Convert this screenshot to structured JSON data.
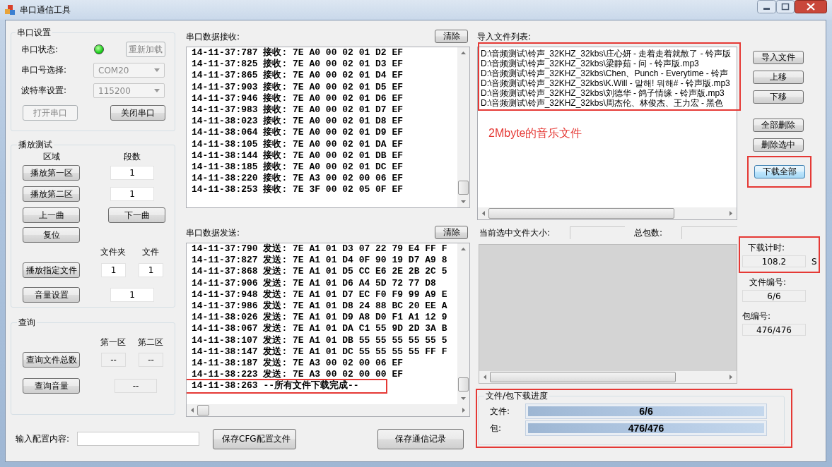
{
  "window": {
    "title": "串口通信工具"
  },
  "serial_settings": {
    "title": "串口设置",
    "status_label": "串口状态:",
    "connected": true,
    "reload_button": {
      "label": "重新加载",
      "disabled": true
    },
    "port_label": "串口号选择:",
    "port": {
      "value": "COM20",
      "disabled": true
    },
    "baud_label": "波特率设置:",
    "baud": {
      "value": "115200",
      "disabled": true
    },
    "open_button": {
      "label": "打开串口",
      "disabled": true
    },
    "close_button": {
      "label": "关闭串口",
      "disabled": false
    }
  },
  "play_test": {
    "title": "播放测试",
    "zone_header": "区域",
    "count_header": "段数",
    "zone1_button": "播放第一区",
    "zone1_count": "1",
    "zone2_button": "播放第二区",
    "zone2_count": "1",
    "prev_button": "上一曲",
    "next_button": "下一曲",
    "reset_button": "复位",
    "folder_header": "文件夹",
    "file_header": "文件",
    "play_file_button": "播放指定文件",
    "folder_value": "1",
    "file_value": "1",
    "volume_button": "音量设置",
    "volume_value": "1"
  },
  "query": {
    "title": "查询",
    "zone1_header": "第一区",
    "zone2_header": "第二区",
    "file_count_button": "查询文件总数",
    "zone1_count": "--",
    "zone2_count": "--",
    "volume_button": "查询音量",
    "volume": "--"
  },
  "config": {
    "label": "输入配置内容:",
    "save_cfg_button": "保存CFG配置文件",
    "save_log_button": "保存通信记录"
  },
  "receive": {
    "label": "串口数据接收:",
    "clear_button": "清除",
    "lines": [
      "14-11-37:787 接收: 7E A0 00 02 01 D2 EF",
      "14-11-37:825 接收: 7E A0 00 02 01 D3 EF",
      "14-11-37:865 接收: 7E A0 00 02 01 D4 EF",
      "14-11-37:903 接收: 7E A0 00 02 01 D5 EF",
      "14-11-37:946 接收: 7E A0 00 02 01 D6 EF",
      "14-11-37:983 接收: 7E A0 00 02 01 D7 EF",
      "14-11-38:023 接收: 7E A0 00 02 01 D8 EF",
      "14-11-38:064 接收: 7E A0 00 02 01 D9 EF",
      "14-11-38:105 接收: 7E A0 00 02 01 DA EF",
      "14-11-38:144 接收: 7E A0 00 02 01 DB EF",
      "14-11-38:185 接收: 7E A0 00 02 01 DC EF",
      "14-11-38:220 接收: 7E A3 00 02 00 06 EF",
      "14-11-38:253 接收: 7E 3F 00 02 05 0F EF"
    ]
  },
  "send": {
    "label": "串口数据发送:",
    "clear_button": "清除",
    "lines": [
      {
        "text": "14-11-37:790 发送: 7E A1 01 D3 07 22 79 E4 FF F",
        "highlighted": false
      },
      {
        "text": "14-11-37:827 发送: 7E A1 01 D4 0F 90 19 D7 A9 8",
        "highlighted": false
      },
      {
        "text": "14-11-37:868 发送: 7E A1 01 D5 CC E6 2E 2B 2C 5",
        "highlighted": false
      },
      {
        "text": "14-11-37:906 发送: 7E A1 01 D6 A4 5D 72 77 D8",
        "highlighted": false
      },
      {
        "text": "14-11-37:948 发送: 7E A1 01 D7 EC F0 F9 99 A9 E",
        "highlighted": false
      },
      {
        "text": "14-11-37:986 发送: 7E A1 01 D8 24 88 BC 20 EE A",
        "highlighted": false
      },
      {
        "text": "14-11-38:026 发送: 7E A1 01 D9 A8 D0 F1 A1 12 9",
        "highlighted": false
      },
      {
        "text": "14-11-38:067 发送: 7E A1 01 DA C1 55 9D 2D 3A B",
        "highlighted": false
      },
      {
        "text": "14-11-38:107 发送: 7E A1 01 DB 55 55 55 55 55 5",
        "highlighted": false
      },
      {
        "text": "14-11-38:147 发送: 7E A1 01 DC 55 55 55 55 FF F",
        "highlighted": false
      },
      {
        "text": "14-11-38:187 发送: 7E A3 00 02 00 06 EF",
        "highlighted": false
      },
      {
        "text": "14-11-38:223 发送: 7E A3 00 02 00 00 EF",
        "highlighted": false
      },
      {
        "text": "14-11-38:263 --所有文件下载完成--",
        "highlighted": true
      }
    ]
  },
  "file_list": {
    "label": "导入文件列表:",
    "items": [
      "D:\\音频测试\\铃声_32KHZ_32kbs\\庄心妍 - 走着走着就散了 - 铃声版",
      "D:\\音频测试\\铃声_32KHZ_32kbs\\梁静茹 - 问 - 铃声版.mp3",
      "D:\\音频测试\\铃声_32KHZ_32kbs\\Chen、Punch - Everytime - 铃声",
      "D:\\音频测试\\铃声_32KHZ_32kbs\\K.Will - 말해! 뭐해# - 铃声版.mp3",
      "D:\\音频测试\\铃声_32KHZ_32kbs\\刘德华 - 鸽子情缘 - 铃声版.mp3",
      "D:\\音频测试\\铃声_32KHZ_32kbs\\周杰伦、林俊杰、王力宏 - 黑色"
    ],
    "annotation": "2Mbyte的音乐文件"
  },
  "file_size_label": "当前选中文件大小:",
  "total_packets_label": "总包数:",
  "side_buttons": [
    {
      "label": "导入文件",
      "focused": false
    },
    {
      "label": "上移",
      "focused": false
    },
    {
      "label": "下移",
      "focused": false
    },
    {
      "label": "全部删除",
      "focused": false
    },
    {
      "label": "删除选中",
      "focused": false
    },
    {
      "label": "下载全部",
      "focused": true
    }
  ],
  "timer": {
    "label": "下载计时:",
    "value": "108.2",
    "unit": "S"
  },
  "file_number": {
    "label": "文件编号:",
    "value": "6/6"
  },
  "packet_number": {
    "label": "包编号:",
    "value": "476/476"
  },
  "progress": {
    "title": "文件/包下载进度",
    "bars": [
      {
        "label": "文件:",
        "text": "6/6",
        "level": 1
      },
      {
        "label": "包:",
        "text": "476/476",
        "level": 1
      }
    ]
  }
}
